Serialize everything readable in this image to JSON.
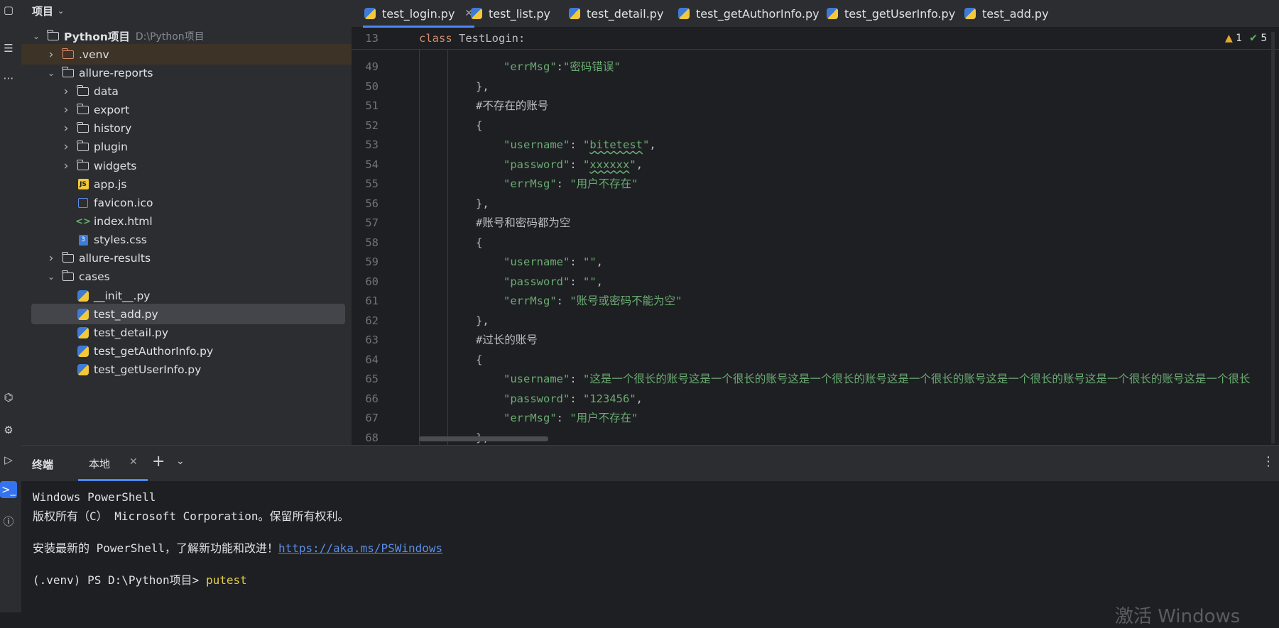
{
  "project_panel": {
    "title": "项目",
    "tree": [
      {
        "label": "Python项目",
        "suffix": "D:\\Python项目",
        "kind": "folder-root",
        "depth": 0,
        "expanded": true
      },
      {
        "label": ".venv",
        "kind": "folder-orange",
        "depth": 1,
        "expanded": false
      },
      {
        "label": "allure-reports",
        "kind": "folder",
        "depth": 1,
        "expanded": true
      },
      {
        "label": "data",
        "kind": "folder",
        "depth": 2,
        "expanded": false
      },
      {
        "label": "export",
        "kind": "folder",
        "depth": 2,
        "expanded": false
      },
      {
        "label": "history",
        "kind": "folder",
        "depth": 2,
        "expanded": false
      },
      {
        "label": "plugin",
        "kind": "folder",
        "depth": 2,
        "expanded": false
      },
      {
        "label": "widgets",
        "kind": "folder",
        "depth": 2,
        "expanded": false
      },
      {
        "label": "app.js",
        "kind": "js",
        "depth": 2
      },
      {
        "label": "favicon.ico",
        "kind": "ico",
        "depth": 2
      },
      {
        "label": "index.html",
        "kind": "html",
        "depth": 2
      },
      {
        "label": "styles.css",
        "kind": "css",
        "depth": 2
      },
      {
        "label": "allure-results",
        "kind": "folder",
        "depth": 1,
        "expanded": false
      },
      {
        "label": "cases",
        "kind": "folder",
        "depth": 1,
        "expanded": true
      },
      {
        "label": "__init__.py",
        "kind": "py",
        "depth": 2
      },
      {
        "label": "test_add.py",
        "kind": "py",
        "depth": 2,
        "selected": true
      },
      {
        "label": "test_detail.py",
        "kind": "py",
        "depth": 2
      },
      {
        "label": "test_getAuthorInfo.py",
        "kind": "py",
        "depth": 2
      },
      {
        "label": "test_getUserInfo.py",
        "kind": "py",
        "depth": 2
      }
    ]
  },
  "editor": {
    "tabs": [
      {
        "label": "test_login.py",
        "active": true
      },
      {
        "label": "test_list.py"
      },
      {
        "label": "test_detail.py"
      },
      {
        "label": "test_getAuthorInfo.py"
      },
      {
        "label": "test_getUserInfo.py"
      },
      {
        "label": "test_add.py"
      }
    ],
    "sticky_line": {
      "number": "13",
      "keyword": "class",
      "name": " TestLogin:"
    },
    "inspections": {
      "warnings": "1",
      "ok": "5"
    },
    "lines": [
      {
        "n": "49",
        "indent": 3,
        "parts": [
          {
            "t": "\"errMsg\"",
            "c": "str"
          },
          {
            "t": ":",
            "c": "txt"
          },
          {
            "t": "\"密码错误\"",
            "c": "str"
          }
        ]
      },
      {
        "n": "50",
        "indent": 2,
        "parts": [
          {
            "t": "},",
            "c": "txt"
          }
        ]
      },
      {
        "n": "51",
        "indent": 2,
        "parts": [
          {
            "t": "#不存在的账号",
            "c": "cmt"
          }
        ]
      },
      {
        "n": "52",
        "indent": 2,
        "parts": [
          {
            "t": "{",
            "c": "txt"
          }
        ]
      },
      {
        "n": "53",
        "indent": 3,
        "parts": [
          {
            "t": "\"username\"",
            "c": "str"
          },
          {
            "t": ": ",
            "c": "txt"
          },
          {
            "t": "\"",
            "c": "str"
          },
          {
            "t": "bitetest",
            "c": "str uline"
          },
          {
            "t": "\"",
            "c": "str"
          },
          {
            "t": ",",
            "c": "txt"
          }
        ]
      },
      {
        "n": "54",
        "indent": 3,
        "parts": [
          {
            "t": "\"password\"",
            "c": "str"
          },
          {
            "t": ": ",
            "c": "txt"
          },
          {
            "t": "\"",
            "c": "str"
          },
          {
            "t": "xxxxxx",
            "c": "str uline"
          },
          {
            "t": "\"",
            "c": "str"
          },
          {
            "t": ",",
            "c": "txt"
          }
        ]
      },
      {
        "n": "55",
        "indent": 3,
        "parts": [
          {
            "t": "\"errMsg\"",
            "c": "str"
          },
          {
            "t": ": ",
            "c": "txt"
          },
          {
            "t": "\"用户不存在\"",
            "c": "str"
          }
        ]
      },
      {
        "n": "56",
        "indent": 2,
        "parts": [
          {
            "t": "},",
            "c": "txt"
          }
        ]
      },
      {
        "n": "57",
        "indent": 2,
        "parts": [
          {
            "t": "#账号和密码都为空",
            "c": "cmt"
          }
        ]
      },
      {
        "n": "58",
        "indent": 2,
        "parts": [
          {
            "t": "{",
            "c": "txt"
          }
        ]
      },
      {
        "n": "59",
        "indent": 3,
        "parts": [
          {
            "t": "\"username\"",
            "c": "str"
          },
          {
            "t": ": ",
            "c": "txt"
          },
          {
            "t": "\"\"",
            "c": "str"
          },
          {
            "t": ",",
            "c": "txt"
          }
        ]
      },
      {
        "n": "60",
        "indent": 3,
        "parts": [
          {
            "t": "\"password\"",
            "c": "str"
          },
          {
            "t": ": ",
            "c": "txt"
          },
          {
            "t": "\"\"",
            "c": "str"
          },
          {
            "t": ",",
            "c": "txt"
          }
        ]
      },
      {
        "n": "61",
        "indent": 3,
        "parts": [
          {
            "t": "\"errMsg\"",
            "c": "str"
          },
          {
            "t": ": ",
            "c": "txt"
          },
          {
            "t": "\"账号或密码不能为空\"",
            "c": "str"
          }
        ]
      },
      {
        "n": "62",
        "indent": 2,
        "parts": [
          {
            "t": "},",
            "c": "txt"
          }
        ]
      },
      {
        "n": "63",
        "indent": 2,
        "parts": [
          {
            "t": "#过长的账号",
            "c": "cmt"
          }
        ]
      },
      {
        "n": "64",
        "indent": 2,
        "parts": [
          {
            "t": "{",
            "c": "txt"
          }
        ]
      },
      {
        "n": "65",
        "indent": 3,
        "parts": [
          {
            "t": "\"username\"",
            "c": "str"
          },
          {
            "t": ": ",
            "c": "txt"
          },
          {
            "t": "\"这是一个很长的账号这是一个很长的账号这是一个很长的账号这是一个很长的账号这是一个很长的账号这是一个很长的账号这是一个很长",
            "c": "str"
          }
        ]
      },
      {
        "n": "66",
        "indent": 3,
        "parts": [
          {
            "t": "\"password\"",
            "c": "str"
          },
          {
            "t": ": ",
            "c": "txt"
          },
          {
            "t": "\"123456\"",
            "c": "str"
          },
          {
            "t": ",",
            "c": "txt"
          }
        ]
      },
      {
        "n": "67",
        "indent": 3,
        "parts": [
          {
            "t": "\"errMsg\"",
            "c": "str"
          },
          {
            "t": ": ",
            "c": "txt"
          },
          {
            "t": "\"用户不存在\"",
            "c": "str"
          }
        ]
      },
      {
        "n": "68",
        "indent": 2,
        "parts": [
          {
            "t": "},",
            "c": "txt"
          }
        ]
      }
    ]
  },
  "terminal": {
    "title": "终端",
    "tab_label": "本地",
    "lines": [
      {
        "parts": [
          {
            "t": "Windows PowerShell",
            "c": ""
          }
        ]
      },
      {
        "parts": [
          {
            "t": "版权所有（C） Microsoft Corporation。保留所有权利。",
            "c": ""
          }
        ]
      },
      {
        "parts": [
          {
            "t": "",
            "c": ""
          }
        ]
      },
      {
        "parts": [
          {
            "t": "安装最新的 PowerShell，了解新功能和改进！",
            "c": ""
          },
          {
            "t": "https://aka.ms/PSWindows",
            "c": "term-link"
          }
        ]
      },
      {
        "parts": [
          {
            "t": "",
            "c": ""
          }
        ]
      },
      {
        "parts": [
          {
            "t": "(.venv) PS D:\\Python项目> ",
            "c": ""
          },
          {
            "t": "putest",
            "c": "term-cmd"
          }
        ]
      }
    ]
  },
  "watermark": "激活 Windows",
  "icons": {
    "tool_window": [
      "project-icon",
      "structure-icon",
      "more-icon",
      "python-packages-icon",
      "services-icon",
      "run-icon",
      "terminal-icon",
      "problems-icon"
    ]
  },
  "colors": {
    "accent": "#3574f0",
    "string": "#6aab73",
    "keyword": "#cf8e6d",
    "link": "#5b8fe8",
    "command": "#e5d04b"
  }
}
